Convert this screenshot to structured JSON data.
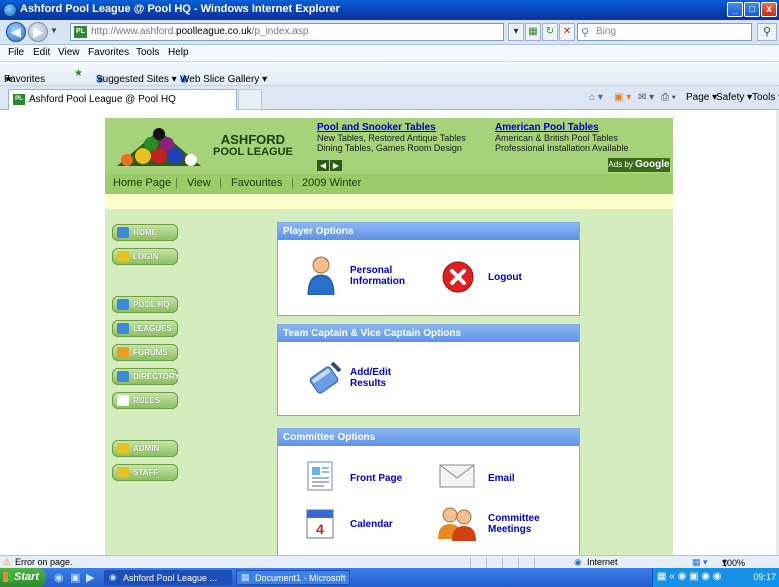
{
  "window": {
    "title": "Ashford Pool League @ Pool HQ - Windows Internet Explorer",
    "min": "_",
    "max": "□",
    "close": "x"
  },
  "address": {
    "url_prefix": "http://www.ashford.",
    "url_domain": "poolleague.co.uk",
    "url_suffix": "/p_index.asp",
    "search_placeholder": "Bing"
  },
  "menu": [
    "File",
    "Edit",
    "View",
    "Favorites",
    "Tools",
    "Help"
  ],
  "favorites_bar": {
    "favorites": "Favorites",
    "suggested": "Suggested Sites ▾",
    "slice": "Web Slice Gallery ▾"
  },
  "tab": {
    "label": "Ashford Pool League @ Pool HQ"
  },
  "commandbar": {
    "page": "Page ▾",
    "safety": "Safety ▾",
    "tools": "Tools ▾"
  },
  "site": {
    "logo_line1": "ASHFORD",
    "logo_line2": "POOL LEAGUE",
    "ad1": {
      "heading": "Pool and Snooker Tables",
      "line1": "New Tables, Restored Antique Tables",
      "line2": "Dining Tables, Games Room Design"
    },
    "ad2": {
      "heading": "American Pool Tables",
      "line1": "American & British Pool Tables",
      "line2": "Professional Installation Available"
    },
    "ads_by": "Ads by",
    "google": "Google",
    "nav": [
      "Home Page",
      "View",
      "Favourites",
      "2009 Winter"
    ],
    "sidebar": [
      {
        "label": "HOME",
        "color": "#3a8ad8"
      },
      {
        "label": "LOGIN",
        "color": "#e8c020"
      },
      {
        "label": "POOL HQ",
        "color": "#3a8ad8"
      },
      {
        "label": "LEAGUES",
        "color": "#3a8ad8"
      },
      {
        "label": "FORUMS",
        "color": "#e8a020"
      },
      {
        "label": "DIRECTORY",
        "color": "#3a8ad8"
      },
      {
        "label": "RULES",
        "color": "#ffffff"
      },
      {
        "label": "ADMIN",
        "color": "#e8c020"
      },
      {
        "label": "STAFF",
        "color": "#e8c020"
      }
    ],
    "player_options": {
      "title": "Player Options",
      "personal_line1": "Personal",
      "personal_line2": "Information",
      "logout": "Logout"
    },
    "team_options": {
      "title": "Team Captain & Vice Captain Options",
      "add_line1": "Add/Edit",
      "add_line2": "Results"
    },
    "committee_options": {
      "title": "Committee Options",
      "front_page": "Front Page",
      "email": "Email",
      "calendar": "Calendar",
      "meetings_line1": "Committee",
      "meetings_line2": "Meetings"
    }
  },
  "status": {
    "error": "Error on page.",
    "zone": "Internet",
    "zoom": "100%"
  },
  "taskbar": {
    "start": "Start",
    "task1": "Ashford Pool League ...",
    "task2": "Document1 - Microsoft ...",
    "clock": "09:17"
  }
}
